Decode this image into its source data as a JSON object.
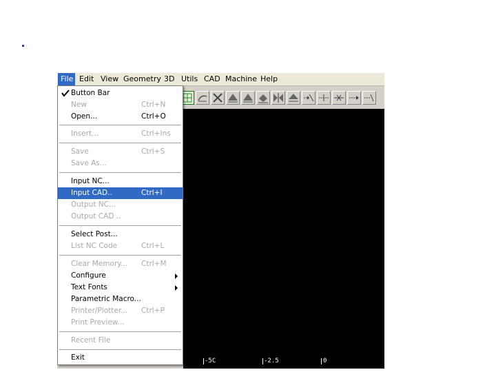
{
  "menubar": {
    "items": [
      {
        "label": "File",
        "active": true
      },
      {
        "label": "Edit"
      },
      {
        "label": "View"
      },
      {
        "label": "Geometry"
      },
      {
        "label": "3D"
      },
      {
        "label": "Utils"
      },
      {
        "label": "CAD"
      },
      {
        "label": "Machine"
      },
      {
        "label": "Help"
      }
    ]
  },
  "file_menu": {
    "items": [
      {
        "label": "Button Bar",
        "shortcut": "",
        "checked": true,
        "enabled": true
      },
      {
        "label": "New",
        "shortcut": "Ctrl+N",
        "enabled": false
      },
      {
        "label": "Open...",
        "shortcut": "Ctrl+O",
        "enabled": true
      },
      {
        "label": "Insert...",
        "shortcut": "Ctrl+Ins",
        "enabled": false
      },
      {
        "label": "Save",
        "shortcut": "Ctrl+S",
        "enabled": false
      },
      {
        "label": "Save As...",
        "shortcut": "",
        "enabled": false
      },
      {
        "label": "Input NC...",
        "shortcut": "",
        "enabled": true
      },
      {
        "label": "Input CAD..",
        "shortcut": "Ctrl+I",
        "enabled": true,
        "highlighted": true
      },
      {
        "label": "Output NC...",
        "shortcut": "",
        "enabled": false
      },
      {
        "label": "Output CAD ..",
        "shortcut": "",
        "enabled": false
      },
      {
        "label": "Select Post...",
        "shortcut": "",
        "enabled": true
      },
      {
        "label": "List NC Code",
        "shortcut": "Ctrl+L",
        "enabled": false
      },
      {
        "label": "Clear Memory...",
        "shortcut": "Ctrl+M",
        "enabled": false
      },
      {
        "label": "Configure",
        "shortcut": "",
        "enabled": true,
        "submenu": true
      },
      {
        "label": "Text Fonts",
        "shortcut": "",
        "enabled": true,
        "submenu": true
      },
      {
        "label": "Parametric Macro...",
        "shortcut": "",
        "enabled": true
      },
      {
        "label": "Printer/Plotter...",
        "shortcut": "Ctrl+P",
        "enabled": false
      },
      {
        "label": "Print Preview...",
        "shortcut": "",
        "enabled": false
      },
      {
        "label": "Recent File",
        "shortcut": "",
        "enabled": false
      },
      {
        "label": "Exit",
        "shortcut": "",
        "enabled": true
      }
    ]
  },
  "toolbar": {
    "buttons": [
      "arc-icon",
      "delete-icon",
      "arrow-up-icon",
      "arrow-up-icon",
      "arrow-up-icon",
      "mirror-icon",
      "arrow-up-icon",
      "trim-icon",
      "extend-icon",
      "break-icon",
      "extend-right-icon",
      "extend-icon"
    ]
  },
  "axis": {
    "ticks": [
      "-5C",
      "-2.5",
      "0"
    ]
  },
  "colors": {
    "highlight": "#316ac5",
    "menubar": "#ece9d8",
    "canvas": "#000000"
  }
}
